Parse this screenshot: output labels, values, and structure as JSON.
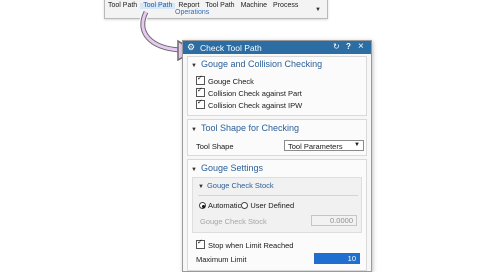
{
  "toolbar": {
    "tabs": [
      "Tool Path",
      "Tool Path",
      "Report",
      "Tool Path",
      "Machine",
      "Process"
    ],
    "group_label": "Operations"
  },
  "dialog": {
    "title": "Check Tool Path",
    "sections": {
      "gouge_collision": {
        "heading": "Gouge and Collision Checking",
        "items": [
          {
            "label": "Gouge Check",
            "checked": true
          },
          {
            "label": "Collision Check against Part",
            "checked": true
          },
          {
            "label": "Collision Check against IPW",
            "checked": true
          }
        ]
      },
      "tool_shape": {
        "heading": "Tool Shape for Checking",
        "label": "Tool Shape",
        "value": "Tool Parameters"
      },
      "gouge_settings": {
        "heading": "Gouge Settings",
        "stock": {
          "heading": "Gouge Check Stock",
          "options": [
            "Automatic",
            "User Defined"
          ],
          "selected": "Automatic",
          "field_label": "Gouge Check Stock",
          "field_value": "0.0000"
        },
        "stop_label": "Stop when Limit Reached",
        "stop_checked": true,
        "max_label": "Maximum Limit",
        "max_value": "10"
      }
    }
  }
}
